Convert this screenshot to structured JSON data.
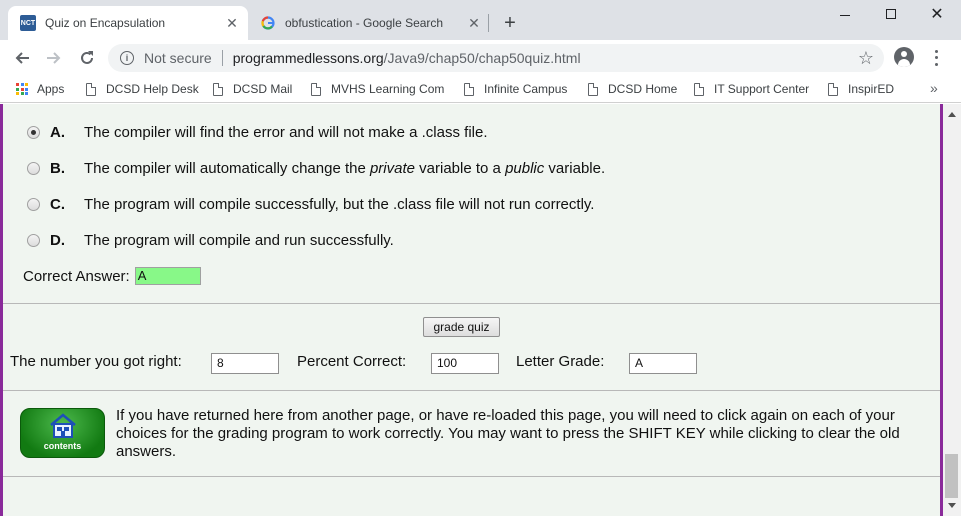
{
  "browser": {
    "tabs": [
      {
        "title": "Quiz on Encapsulation",
        "favicon": "nct-icon",
        "favicon_text": "NCT",
        "active": true
      },
      {
        "title": "obfustication - Google Search",
        "favicon": "google-icon",
        "active": false
      }
    ],
    "omnibox": {
      "security": "Not secure",
      "url_host": "programmedlessons.org",
      "url_path": "/Java9/chap50/chap50quiz.html"
    },
    "bookmarks": [
      {
        "label": "Apps",
        "icon": "apps-grid-icon"
      },
      {
        "label": "DCSD Help Desk",
        "icon": "page-icon"
      },
      {
        "label": "DCSD Mail",
        "icon": "page-icon"
      },
      {
        "label": "MVHS Learning Com",
        "icon": "page-icon"
      },
      {
        "label": "Infinite Campus",
        "icon": "page-icon"
      },
      {
        "label": "DCSD Home",
        "icon": "page-icon"
      },
      {
        "label": "IT Support Center",
        "icon": "page-icon"
      },
      {
        "label": "InspirED",
        "icon": "page-icon"
      }
    ],
    "bookmarks_overflow": "»"
  },
  "quiz": {
    "options": [
      {
        "letter": "A.",
        "text_before": "The compiler will find the error and will not make a .class file.",
        "selected": true
      },
      {
        "letter": "B.",
        "text_before": "The compiler will automatically change the ",
        "italic1": "private",
        "text_mid": " variable to a ",
        "italic2": "public",
        "text_after": " variable.",
        "selected": false
      },
      {
        "letter": "C.",
        "text_before": "The program will compile successfully, but the .class file will not run correctly.",
        "selected": false
      },
      {
        "letter": "D.",
        "text_before": "The program will compile and run successfully.",
        "selected": false
      }
    ],
    "correct_label": "Correct Answer:",
    "correct_value": "A",
    "correct_color": "#88f888",
    "grade_button": "grade quiz",
    "number_right_label": "The number you got right:",
    "number_right_value": "8",
    "percent_label": "Percent Correct:",
    "percent_value": "100",
    "letter_label": "Letter Grade:",
    "letter_value": "A",
    "contents_label": "contents",
    "note": "If you have returned here from another page, or have re-loaded this page, you will need to click again on each of your choices for the grading program to work correctly. You may want to press the SHIFT KEY while clicking to clear the old answers."
  },
  "colors": {
    "page_bg": "#f0f5f0",
    "frame_border": "#8a2a9a",
    "contents_button": "#2e9a2e"
  }
}
